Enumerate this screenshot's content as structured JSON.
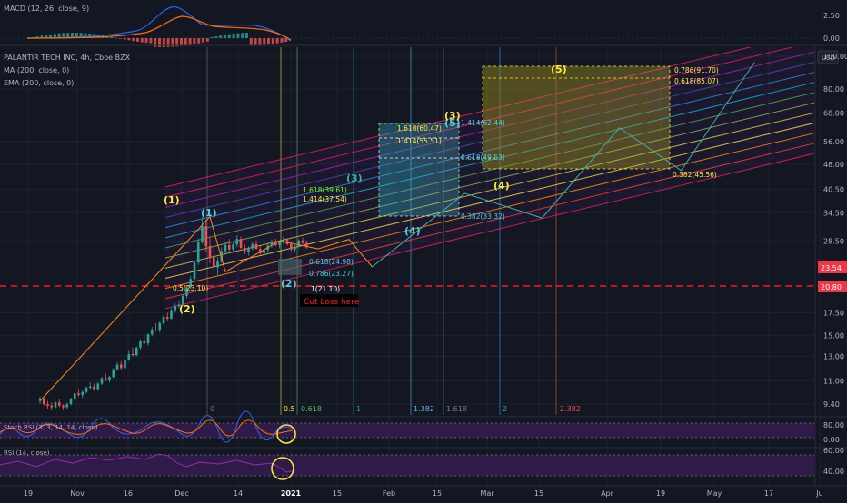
{
  "legends": {
    "macd": "MACD (12, 26, close, 9)",
    "symbol": "PALANTIR TECH INC, 4h, Cboe BZX",
    "ma": "MA (200, close, 0)",
    "ema": "EMA (200, close, 0)",
    "stoch": "Stoch RSI (3, 3, 14, 14, close)",
    "rsi": "RSI (14, close)"
  },
  "currency": "USD",
  "colors": {
    "bg": "#131722",
    "grid": "#1e2230",
    "axis_text": "#b2b5be",
    "price_red": "#f23645",
    "support_red": "#ff1a1a",
    "macd_line": "#2962ff",
    "signal_line": "#ff6d00",
    "orange_path": "#f57f17",
    "teal_path": "#3bb3a6",
    "wave_yellow": "#ffeb3b",
    "wave_cyan": "#4dd0e1",
    "osc_fill": "#3a1e55",
    "osc_line": "#9c27b0",
    "circle_yellow": "#ffeb3b"
  },
  "chart_data": {
    "type": "candlestick",
    "title": "PALANTIR TECH INC, 4h, Cboe BZX",
    "yscale": "log",
    "ylim": [
      8.5,
      102
    ],
    "xlabels": [
      "19",
      "Nov",
      "16",
      "Dec",
      "14",
      "2021",
      "15",
      "Feb",
      "15",
      "Mar",
      "15",
      "Apr",
      "19",
      "May",
      "17",
      "Ju"
    ],
    "y_ticks": [
      "100.00",
      "80.00",
      "68.00",
      "56.00",
      "48.00",
      "40.50",
      "34.50",
      "28.50",
      "23.54",
      "20.80",
      "17.50",
      "15.00",
      "13.00",
      "11.00",
      "9.40"
    ],
    "price_badges": [
      {
        "label": "23.54",
        "color": "#f23645"
      },
      {
        "label": "20.80",
        "color": "#f23645"
      }
    ],
    "macd_ticks": [
      "2.50",
      "0.00"
    ],
    "stoch_ticks": [
      "80.00",
      "0.00"
    ],
    "rsi_ticks": [
      "60.00",
      "40.00"
    ],
    "support_level": 20.8,
    "wave_labels": [
      {
        "text": "(1)",
        "color": "yellow"
      },
      {
        "text": "(2)",
        "color": "yellow"
      },
      {
        "text": "(1)",
        "color": "cyan"
      },
      {
        "text": "(2)",
        "color": "cyan"
      },
      {
        "text": "(3)",
        "color": "teal"
      },
      {
        "text": "(4)",
        "color": "cyan"
      },
      {
        "text": "(5)",
        "color": "cyan"
      },
      {
        "text": "(3)",
        "color": "yellow"
      },
      {
        "text": "(4)",
        "color": "yellow"
      },
      {
        "text": "(5)",
        "color": "yellow"
      }
    ],
    "fib_labels": [
      "0.5(23.10)",
      "0.618(24.98)",
      "0.786(23.27)",
      "1(21.10)",
      "1.618(39.61)",
      "1.414(37.54)",
      "0.382(33.32)",
      "1.618(60.47)",
      "1.414(55.51)",
      "0.618(49.53)",
      "1.414(62.44)",
      "0.786(91.70)",
      "0.618(85.07)",
      "0.382(45.56)"
    ],
    "fib_time_labels": [
      "0",
      "0.5",
      "0.618",
      "1",
      "1.382",
      "1.618",
      "2",
      "2.382"
    ],
    "annotation": "Cut Loss here",
    "candles": [
      [
        9.6,
        9.9,
        9.4,
        9.7
      ],
      [
        9.7,
        9.8,
        9.3,
        9.4
      ],
      [
        9.4,
        9.6,
        9.1,
        9.3
      ],
      [
        9.3,
        9.5,
        9.0,
        9.2
      ],
      [
        9.2,
        9.6,
        9.1,
        9.5
      ],
      [
        9.5,
        9.7,
        9.2,
        9.3
      ],
      [
        9.3,
        9.4,
        9.0,
        9.2
      ],
      [
        9.2,
        9.5,
        9.1,
        9.4
      ],
      [
        9.4,
        9.8,
        9.3,
        9.7
      ],
      [
        9.7,
        10.2,
        9.6,
        10.1
      ],
      [
        10.1,
        10.4,
        9.9,
        10.0
      ],
      [
        10.0,
        10.3,
        9.8,
        10.2
      ],
      [
        10.2,
        10.6,
        10.1,
        10.5
      ],
      [
        10.5,
        10.9,
        10.4,
        10.6
      ],
      [
        10.6,
        10.8,
        10.3,
        10.4
      ],
      [
        10.4,
        10.9,
        10.3,
        10.8
      ],
      [
        10.8,
        11.3,
        10.7,
        11.2
      ],
      [
        11.2,
        11.6,
        11.0,
        11.1
      ],
      [
        11.1,
        11.4,
        10.9,
        11.3
      ],
      [
        11.3,
        12.0,
        11.2,
        11.9
      ],
      [
        11.9,
        12.5,
        11.8,
        12.3
      ],
      [
        12.3,
        12.6,
        11.9,
        12.0
      ],
      [
        12.0,
        12.8,
        11.9,
        12.7
      ],
      [
        12.7,
        13.5,
        12.6,
        13.2
      ],
      [
        13.2,
        13.8,
        13.0,
        13.1
      ],
      [
        13.1,
        13.9,
        13.0,
        13.8
      ],
      [
        13.8,
        14.6,
        13.6,
        14.4
      ],
      [
        14.4,
        15.0,
        14.1,
        14.2
      ],
      [
        14.2,
        15.2,
        14.0,
        15.1
      ],
      [
        15.1,
        15.9,
        14.9,
        15.6
      ],
      [
        15.6,
        16.3,
        15.4,
        15.5
      ],
      [
        15.5,
        16.5,
        15.3,
        16.3
      ],
      [
        16.3,
        17.2,
        16.1,
        17.0
      ],
      [
        17.0,
        17.5,
        16.6,
        16.8
      ],
      [
        16.8,
        18.0,
        16.7,
        17.8
      ],
      [
        17.8,
        18.6,
        17.5,
        18.3
      ],
      [
        18.3,
        19.0,
        18.0,
        18.5
      ],
      [
        18.5,
        19.8,
        18.3,
        19.6
      ],
      [
        19.6,
        21.0,
        19.3,
        20.8
      ],
      [
        20.8,
        22.5,
        20.5,
        22.0
      ],
      [
        22.0,
        25.0,
        21.8,
        24.6
      ],
      [
        24.6,
        29.0,
        24.2,
        28.4
      ],
      [
        28.4,
        33.5,
        27.9,
        31.5
      ],
      [
        31.5,
        33.0,
        26.5,
        27.5
      ],
      [
        27.5,
        29.5,
        24.5,
        25.5
      ],
      [
        25.5,
        27.0,
        23.0,
        23.8
      ],
      [
        23.8,
        25.5,
        22.6,
        24.9
      ],
      [
        24.9,
        27.3,
        24.5,
        26.6
      ],
      [
        26.6,
        28.3,
        25.9,
        27.7
      ],
      [
        27.7,
        28.9,
        26.5,
        26.9
      ],
      [
        26.9,
        28.2,
        26.3,
        27.8
      ],
      [
        27.8,
        29.6,
        27.3,
        28.9
      ],
      [
        28.9,
        29.4,
        27.0,
        27.2
      ],
      [
        27.2,
        27.9,
        26.0,
        26.4
      ],
      [
        26.4,
        27.5,
        25.8,
        27.1
      ],
      [
        27.1,
        28.3,
        26.7,
        27.9
      ],
      [
        27.9,
        28.6,
        26.9,
        27.0
      ],
      [
        27.0,
        27.6,
        25.9,
        26.2
      ],
      [
        26.2,
        27.0,
        25.5,
        26.8
      ],
      [
        26.8,
        27.9,
        26.4,
        27.6
      ],
      [
        27.6,
        28.8,
        27.2,
        28.4
      ],
      [
        28.4,
        28.9,
        27.4,
        27.7
      ],
      [
        27.7,
        28.5,
        27.1,
        28.2
      ],
      [
        28.2,
        29.3,
        27.9,
        28.7
      ],
      [
        28.7,
        29.0,
        27.6,
        27.9
      ],
      [
        27.9,
        28.4,
        26.6,
        26.9
      ],
      [
        26.9,
        27.7,
        26.3,
        27.4
      ],
      [
        27.4,
        28.9,
        27.1,
        28.6
      ],
      [
        28.6,
        29.2,
        27.9,
        28.1
      ],
      [
        28.1,
        28.6,
        27.0,
        27.3
      ]
    ],
    "orange_path": [
      [
        0,
        9.6
      ],
      [
        44,
        33.6
      ],
      [
        48,
        23.1
      ],
      [
        62,
        28.5
      ],
      [
        72,
        27.0
      ],
      [
        80,
        28.8
      ],
      [
        86,
        23.9
      ]
    ],
    "teal_path": [
      [
        86,
        23.9
      ],
      [
        110,
        39.4
      ],
      [
        130,
        33.3
      ],
      [
        150,
        61.5
      ],
      [
        166,
        46.0
      ],
      [
        185,
        96.0
      ]
    ],
    "waves": {
      "yellow": [
        "(1)",
        "(2)",
        "(3)",
        "(4)",
        "(5)"
      ],
      "cyan": [
        "(1)",
        "(2)",
        "(3)",
        "(4)",
        "(5)"
      ]
    }
  }
}
